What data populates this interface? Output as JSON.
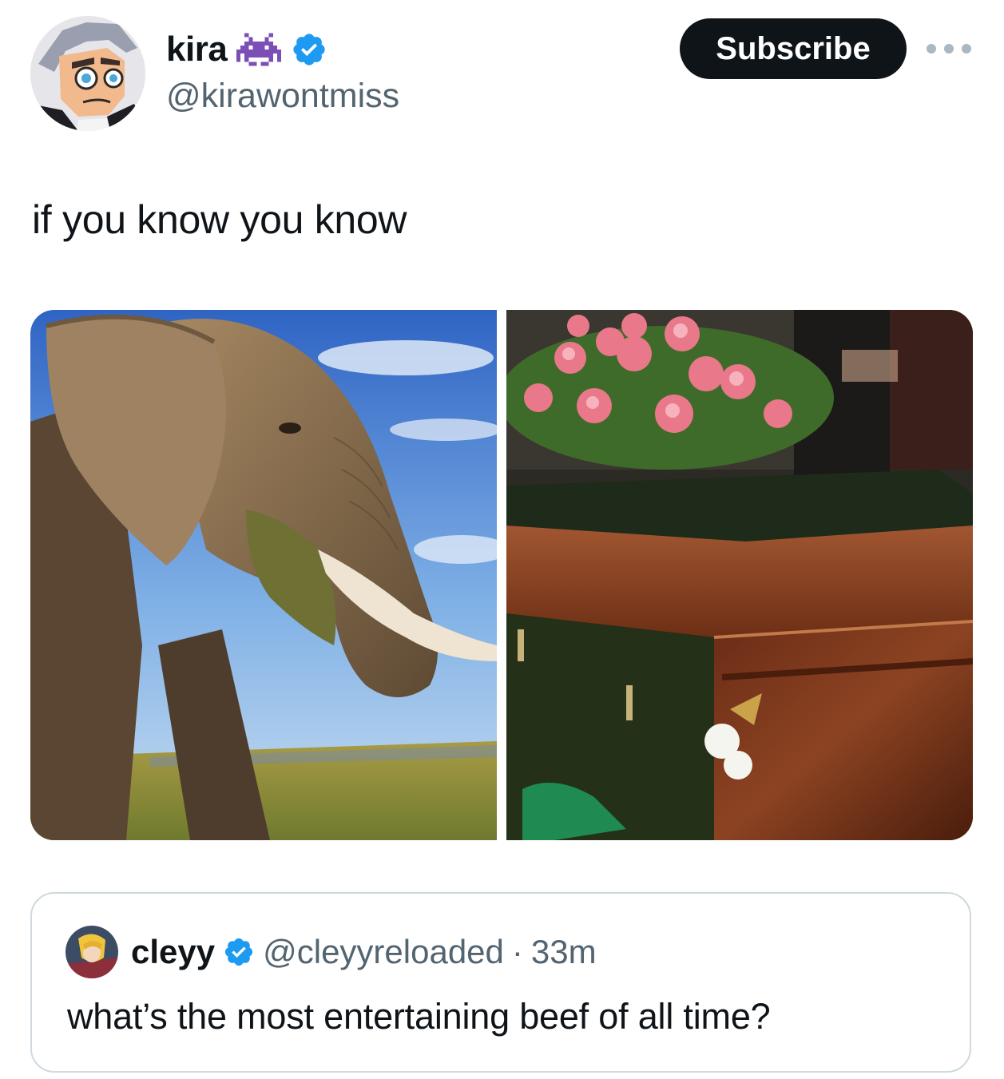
{
  "post": {
    "author": {
      "display_name": "kira",
      "handle": "@kirawontmiss",
      "name_emoji_icon": "alien-monster-icon",
      "verified": true
    },
    "subscribe_label": "Subscribe",
    "more_icon": "more-horizontal-icon",
    "text": "if you know you know",
    "media": [
      {
        "icon": "elephant-photo"
      },
      {
        "icon": "casket-with-flowers-photo"
      }
    ]
  },
  "quoted_post": {
    "author": {
      "display_name": "cleyy",
      "handle": "@cleyyreloaded",
      "verified": true
    },
    "separator": "·",
    "time": "33m",
    "text": "what’s the most entertaining beef of all time?"
  },
  "colors": {
    "text": "#0f1419",
    "secondary_text": "#536471",
    "verified_blue": "#1d9bf0",
    "button_bg": "#0f1419",
    "border": "#cfd9de",
    "emoji_purple": "#7b4fb5"
  }
}
